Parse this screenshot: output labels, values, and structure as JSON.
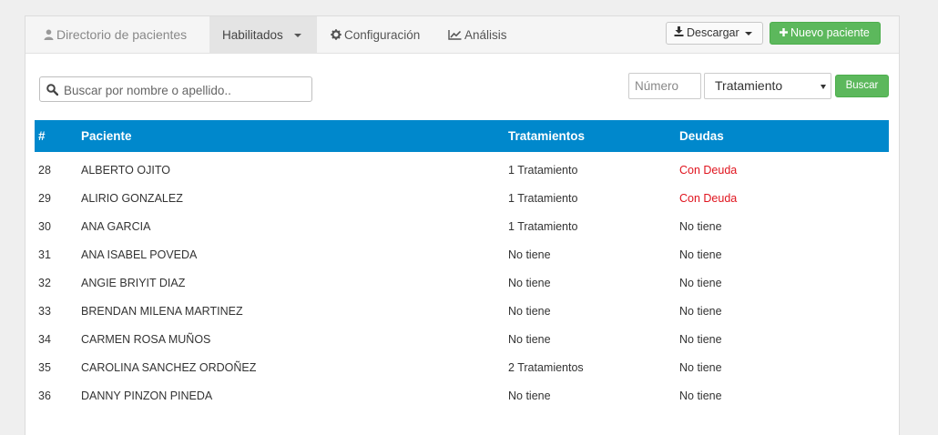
{
  "tabs": {
    "directory": "Directorio de pacientes",
    "enabled": "Habilitados",
    "config": "Configuración",
    "analysis": "Análisis"
  },
  "actions": {
    "download": "Descargar",
    "new_patient": "Nuevo paciente"
  },
  "search": {
    "placeholder": "Buscar por nombre o apellido..",
    "number_placeholder": "Número",
    "treatment_selected": "Tratamiento",
    "button": "Buscar"
  },
  "table": {
    "headers": {
      "num": "#",
      "patient": "Paciente",
      "treatments": "Tratamientos",
      "debts": "Deudas"
    },
    "rows": [
      {
        "num": "28",
        "name": "ALBERTO OJITO",
        "treatments": "1 Tratamiento",
        "debt": "Con Deuda",
        "has_debt": true
      },
      {
        "num": "29",
        "name": "ALIRIO GONZALEZ",
        "treatments": "1 Tratamiento",
        "debt": "Con Deuda",
        "has_debt": true
      },
      {
        "num": "30",
        "name": "ANA GARCIA",
        "treatments": "1 Tratamiento",
        "debt": "No tiene",
        "has_debt": false
      },
      {
        "num": "31",
        "name": "ANA ISABEL POVEDA",
        "treatments": "No tiene",
        "debt": "No tiene",
        "has_debt": false
      },
      {
        "num": "32",
        "name": "ANGIE BRIYIT DIAZ",
        "treatments": "No tiene",
        "debt": "No tiene",
        "has_debt": false
      },
      {
        "num": "33",
        "name": "BRENDAN MILENA MARTINEZ",
        "treatments": "No tiene",
        "debt": "No tiene",
        "has_debt": false
      },
      {
        "num": "34",
        "name": "CARMEN ROSA MUÑOS",
        "treatments": "No tiene",
        "debt": "No tiene",
        "has_debt": false
      },
      {
        "num": "35",
        "name": "CAROLINA SANCHEZ ORDOÑEZ",
        "treatments": "2 Tratamientos",
        "debt": "No tiene",
        "has_debt": false
      },
      {
        "num": "36",
        "name": "DANNY PINZON PINEDA",
        "treatments": "No tiene",
        "debt": "No tiene",
        "has_debt": false
      }
    ]
  },
  "colors": {
    "header": "#0088cc",
    "success": "#5cb85c",
    "debt": "#e0141e"
  },
  "icons": [
    "user-icon",
    "gear-icon",
    "chart-line-icon",
    "download-icon",
    "plus-icon",
    "search-icon",
    "caret-down-icon"
  ]
}
